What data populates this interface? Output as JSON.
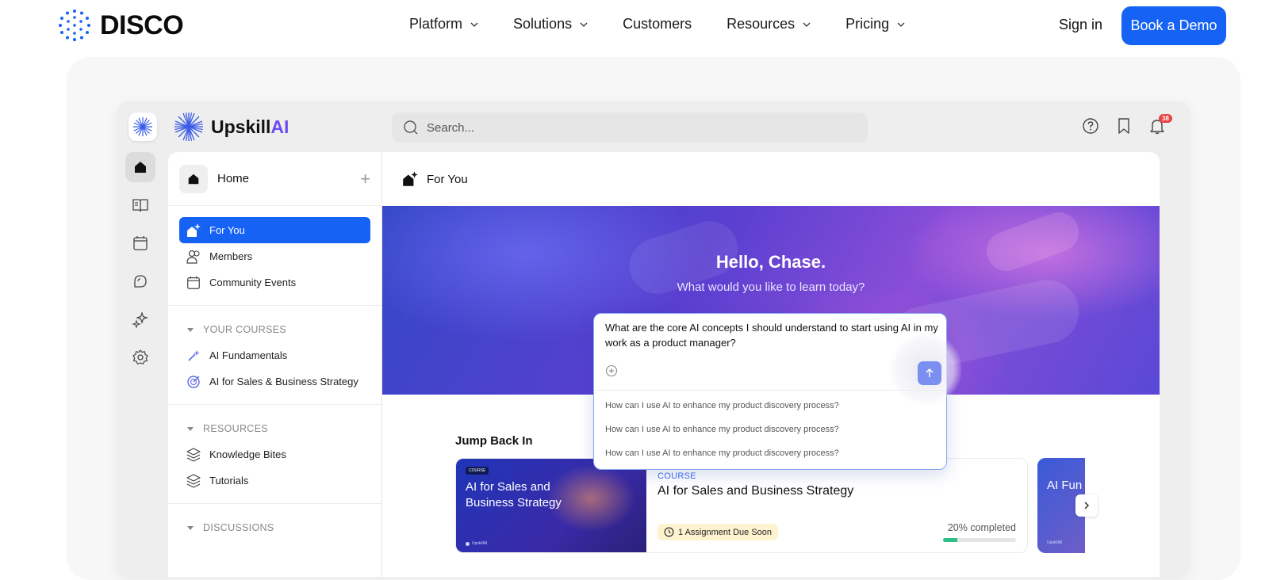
{
  "site": {
    "brand": "DISCO",
    "nav": [
      {
        "label": "Platform",
        "has_menu": true
      },
      {
        "label": "Solutions",
        "has_menu": true
      },
      {
        "label": "Customers",
        "has_menu": false
      },
      {
        "label": "Resources",
        "has_menu": true
      },
      {
        "label": "Pricing",
        "has_menu": true
      }
    ],
    "sign_in": "Sign in",
    "cta": "Book a Demo",
    "cta_color": "#1662f5"
  },
  "app": {
    "logo": {
      "main": "Upskill",
      "accent": "AI"
    },
    "search_placeholder": "Search...",
    "notification_count": "38",
    "rail": [
      "home-icon",
      "book-icon",
      "calendar-icon",
      "chat-icon",
      "sparkle-icon",
      "gear-icon"
    ],
    "sidebar": {
      "title": "Home",
      "items": [
        {
          "label": "For You",
          "icon": "sparkle-house-icon",
          "active": true
        },
        {
          "label": "Members",
          "icon": "users-icon",
          "active": false
        },
        {
          "label": "Community Events",
          "icon": "calendar-icon",
          "active": false
        }
      ],
      "courses_header": "YOUR COURSES",
      "courses": [
        {
          "label": "AI Fundamentals",
          "icon": "wand-icon"
        },
        {
          "label": "AI for Sales & Business Strategy",
          "icon": "target-icon"
        }
      ],
      "resources_header": "RESOURCES",
      "resources": [
        {
          "label": "Knowledge Bites",
          "icon": "layers-icon"
        },
        {
          "label": "Tutorials",
          "icon": "layers-icon"
        }
      ],
      "discussions_header": "DISCUSSIONS"
    },
    "main": {
      "title": "For You",
      "hero_title": "Hello, Chase.",
      "hero_subtitle": "What would you like to learn today?",
      "prompt_text": "What are the core AI concepts I should understand to start using AI in my work as a product manager?",
      "suggestions": [
        "How can I use AI to enhance my product discovery process?",
        "How can I use AI to enhance my product discovery process?",
        "How can I use AI to enhance my product discovery process?"
      ],
      "jump_back_title": "Jump Back In",
      "card": {
        "thumb_tag": "COURSE",
        "thumb_title": "AI for Sales and Business Strategy",
        "thumb_brand": "UpskillAI",
        "kicker": "COURSE",
        "title": "AI for Sales and Business Strategy",
        "badge": "1 Assignment Due Soon",
        "progress_label": "20% completed",
        "progress": 0.2
      },
      "card2": {
        "title": "AI Fun",
        "brand": "UpskillAI"
      }
    }
  }
}
